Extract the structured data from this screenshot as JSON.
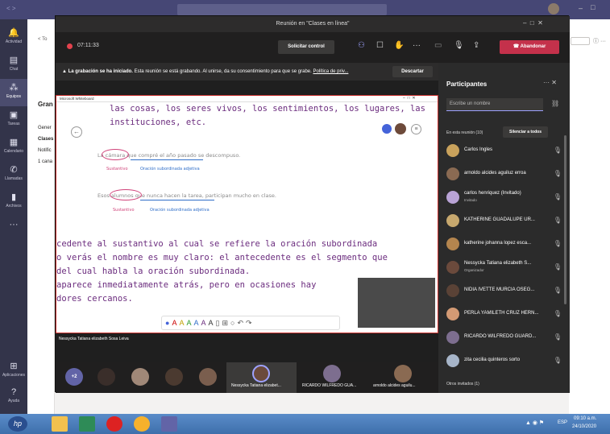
{
  "meeting": {
    "window_title": "Reunión en \"Clases en línea\"",
    "timer": "07:11:33",
    "request_control_label": "Solicitar control",
    "leave_label": "Abandonar"
  },
  "recording_banner": {
    "bold": "La grabación se ha iniciado.",
    "text": "Esta reunión se está grabando. Al unirse, da su consentimiento para que se grabe.",
    "link": "Política de priv...",
    "dismiss_label": "Descartar"
  },
  "whiteboard": {
    "window_title": "Microsoft Whiteboard",
    "line_top1": "las cosas, los seres vivos, los sentimientos, los lugares, las",
    "line_top2": "instituciones, etc.",
    "ex1_sentence": "La cámara que compré el año pasado se descompuso.",
    "ex1_label_noun": "Sustantivo",
    "ex1_label_clause": "Oración subordinada adjetiva",
    "ex2_sentence": "Esos alumnos que nunca hacen la tarea, participan mucho en clase.",
    "ex2_label_noun": "Sustantivo",
    "ex2_label_clause": "Oración subordinada adjetiva",
    "para_1": "cedente al sustantivo al cual se refiere la oración subordinada",
    "para_2": "o verás el nombre es muy claro: el antecedente es el segmento que",
    "para_3": "del cual habla la oración subordinada.",
    "para_4": "aparece inmediatamente atrás, pero en ocasiones hay",
    "para_5": "dores cercanos."
  },
  "presenter_name": "Nessycka Tatiana elizabeth Sosa Leiva",
  "participants_panel": {
    "title": "Participantes",
    "search_placeholder": "Escribe un nombre",
    "in_meeting": "En esta reunión (10)",
    "mute_all": "Silenciar a todos",
    "others": "Otros invitados (1)",
    "people": [
      {
        "name": "Carlos Ingles",
        "sub": "",
        "color": "#c9a25c"
      },
      {
        "name": "arnoldo alcides aguiluz erroa",
        "sub": "",
        "color": "#8a6a52"
      },
      {
        "name": "carlos henriquez (Invitado)",
        "sub": "Invitado",
        "color": "#b9a3d6"
      },
      {
        "name": "KATHERINE GUADALUPE UR...",
        "sub": "",
        "color": "#c7a86e"
      },
      {
        "name": "katherine johanna lopez esca...",
        "sub": "",
        "color": "#b4854e"
      },
      {
        "name": "Nessycka Tatiana elizabeth S...",
        "sub": "Organizador",
        "color": "#6b4a3c"
      },
      {
        "name": "NIDIA IVETTE MURCIA OSEG...",
        "sub": "",
        "color": "#5a4236"
      },
      {
        "name": "PERLA YAMILETH CRUZ HERN...",
        "sub": "",
        "color": "#d39a74"
      },
      {
        "name": "RICARDO WILFREDO GUARD...",
        "sub": "",
        "color": "#7d6e8f"
      },
      {
        "name": "zita cecilia quinteros sorto",
        "sub": "",
        "color": "#a7b5c9"
      }
    ]
  },
  "video_strip": {
    "overflow": "+2",
    "names": [
      "Nessycka Tatiana elizabet...",
      "RICARDO WILFREDO GUA...",
      "arnoldo alcides aguilu..."
    ]
  },
  "teams": {
    "rail": [
      "Actividad",
      "Chat",
      "Equipos",
      "Tareas",
      "Calendario",
      "Llamadas",
      "Archivos",
      "Aplicaciones",
      "Ayuda"
    ],
    "team_name": "Gran",
    "channels": [
      "Gener",
      "Clases",
      "Notific",
      "1 cana"
    ],
    "back_label": "< To"
  },
  "taskbar": {
    "time": "09:10 a.m.",
    "date": "24/10/2020",
    "lang": "ESP"
  }
}
